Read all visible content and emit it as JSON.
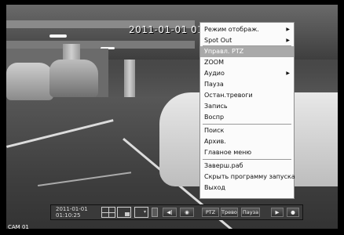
{
  "overlay": {
    "timestamp": "2011-01-01 01:",
    "camera_label": "CAM 01"
  },
  "menu": {
    "items": [
      {
        "label": "Режим отображ.",
        "submenu": true,
        "selected": false
      },
      {
        "label": "Spot Out",
        "submenu": true,
        "selected": false
      },
      {
        "label": "Управл. PTZ",
        "submenu": false,
        "selected": true
      },
      {
        "label": "ZOOM",
        "submenu": false,
        "selected": false
      },
      {
        "label": "Аудио",
        "submenu": true,
        "selected": false
      },
      {
        "label": "Пауза",
        "submenu": false,
        "selected": false
      },
      {
        "label": "Остан.тревоги",
        "submenu": false,
        "selected": false
      },
      {
        "label": "Запись",
        "submenu": false,
        "selected": false
      },
      {
        "label": "Воспр",
        "submenu": false,
        "selected": false
      },
      {
        "label": "Поиск",
        "submenu": false,
        "selected": false
      },
      {
        "label": "Архив.",
        "submenu": false,
        "selected": false
      },
      {
        "label": "Главное меню",
        "submenu": false,
        "selected": false
      },
      {
        "label": "Заверш.раб",
        "submenu": false,
        "selected": false
      },
      {
        "label": "Скрыть программу запуска",
        "submenu": false,
        "selected": false
      },
      {
        "label": "Выход",
        "submenu": false,
        "selected": false
      }
    ]
  },
  "toolbar": {
    "date_time": "2011-01-01\n01:10:25",
    "ptz_label": "PTZ",
    "alarm_label": "Тревога",
    "pause_label": "Пауза",
    "prev_symbol": "◀|",
    "center_symbol": "◉",
    "play_symbol": "▶",
    "record_symbol": "●"
  },
  "colors": {
    "menu_bg": "#fbfbfb",
    "menu_selected": "#a9a9a9",
    "toolbar_bg": "#3a3a3a"
  }
}
